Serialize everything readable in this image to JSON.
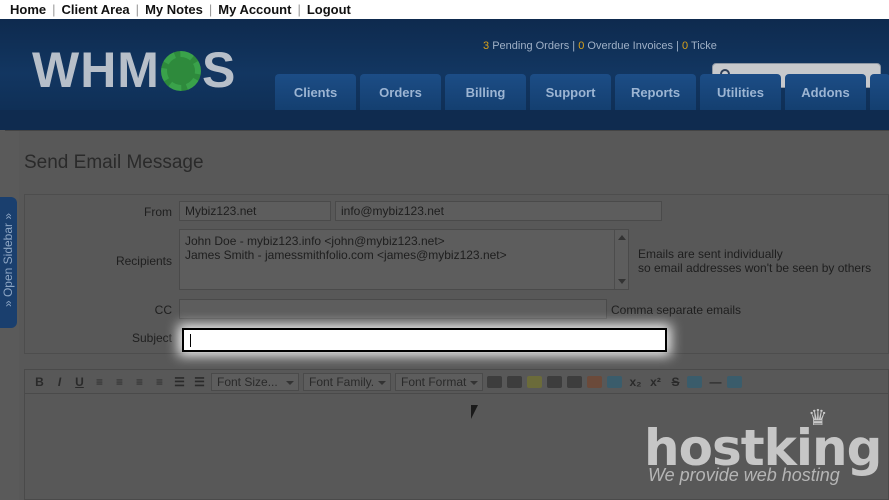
{
  "topnav": [
    "Home",
    "Client Area",
    "My Notes",
    "My Account",
    "Logout"
  ],
  "brand": {
    "pre": "WHM",
    "post": "S"
  },
  "stats": {
    "pending_count": "3",
    "pending_label": "Pending Orders |",
    "overdue_count": "0",
    "overdue_label": "Overdue Invoices |",
    "tickets_count": "0",
    "tickets_label": "Ticke"
  },
  "nav_tabs": [
    "Clients",
    "Orders",
    "Billing",
    "Support",
    "Reports",
    "Utilities",
    "Addons"
  ],
  "sidebar_tab": "» Open Sidebar »",
  "page_title": "Send Email Message",
  "form": {
    "from_label": "From",
    "from_name": "Mybiz123.net",
    "from_email": "info@mybiz123.net",
    "recipients_label": "Recipients",
    "recipients": [
      "John Doe - mybiz123.info <john@mybiz123.net>",
      "James Smith - jamessmithfolio.com <james@mybiz123.net>"
    ],
    "recipients_hint_1": "Emails are sent individually",
    "recipients_hint_2": "so email addresses won't be seen by others",
    "cc_label": "CC",
    "cc_value": "",
    "cc_hint": "Comma separate emails",
    "subject_label": "Subject",
    "subject_value": ""
  },
  "toolbar": {
    "bold": "B",
    "italic": "I",
    "underline": "U",
    "font_size": "Font Size...",
    "font_family": "Font Family.",
    "font_format": "Font Format"
  },
  "watermark": {
    "word": "hostking",
    "tagline": "We provide web hosting"
  }
}
